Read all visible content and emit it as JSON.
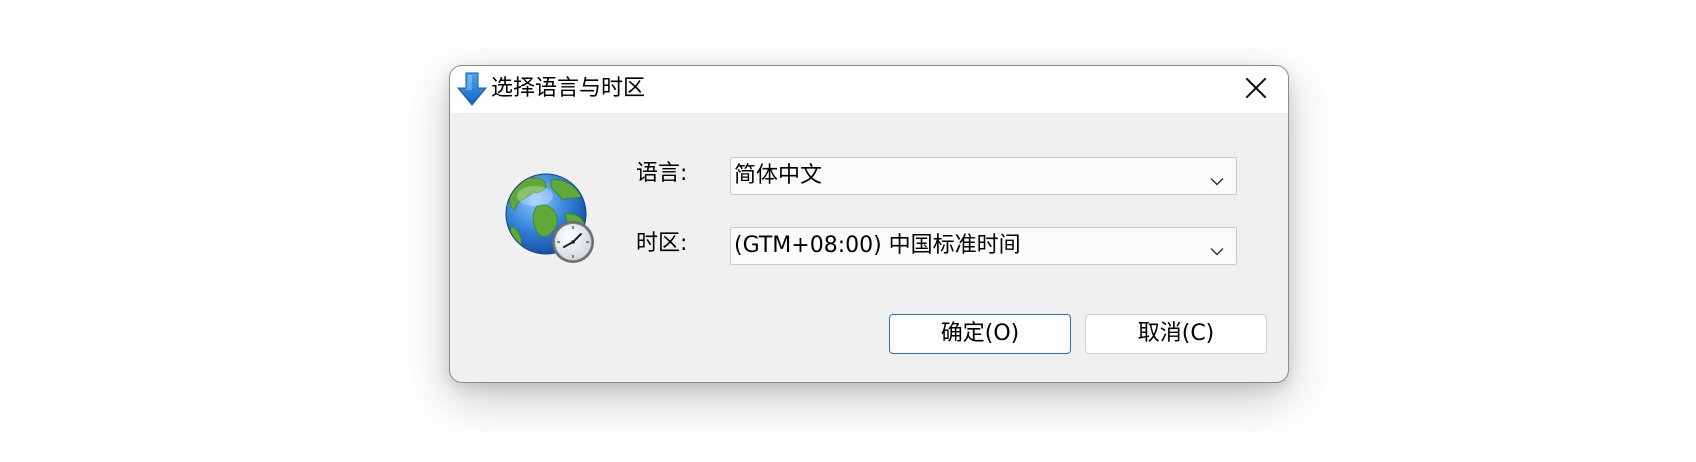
{
  "dialog": {
    "title": "选择语言与时区",
    "title_icon": "download-arrow-icon",
    "close_icon": "close-icon",
    "illustration_icon": "globe-clock-icon"
  },
  "fields": {
    "language": {
      "label": "语言:",
      "value": "简体中文",
      "dropdown_icon": "chevron-down-icon"
    },
    "timezone": {
      "label": "时区:",
      "value": "(GTM+08:00) 中国标准时间",
      "dropdown_icon": "chevron-down-icon"
    }
  },
  "buttons": {
    "ok_label": "确定(O)",
    "cancel_label": "取消(C)"
  },
  "colors": {
    "accent_border": "#2a6fc4",
    "title_icon_blue": "#1e78d7",
    "dialog_background": "#f0f0f0",
    "titlebar_background": "#ffffff"
  }
}
